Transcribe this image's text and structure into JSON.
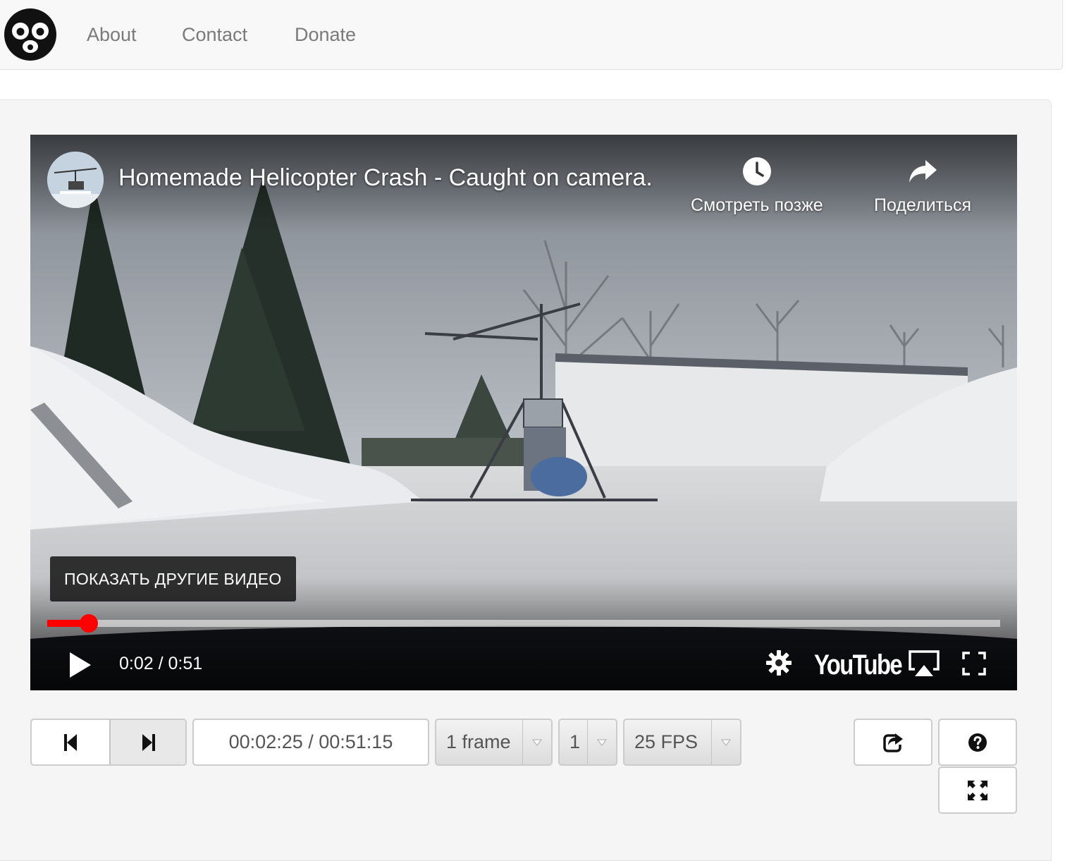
{
  "nav": {
    "logo_icon": "monkey-face-icon",
    "links": [
      "About",
      "Contact",
      "Donate"
    ]
  },
  "video": {
    "title": "Homemade Helicopter Crash - Caught on camera.",
    "watch_later_label": "Смотреть позже",
    "share_label": "Поделиться",
    "more_videos_label": "ПОКАЗАТЬ ДРУГИЕ ВИДЕО",
    "time_display": "0:02 / 0:51",
    "progress_fraction": 0.044,
    "brand_label": "YouTube",
    "accent_color": "#ff0000"
  },
  "controls": {
    "timecode": "00:02:25 / 00:51:15",
    "step_select": "1 frame",
    "multiplier_select": "1",
    "fps_select": "25 FPS"
  }
}
